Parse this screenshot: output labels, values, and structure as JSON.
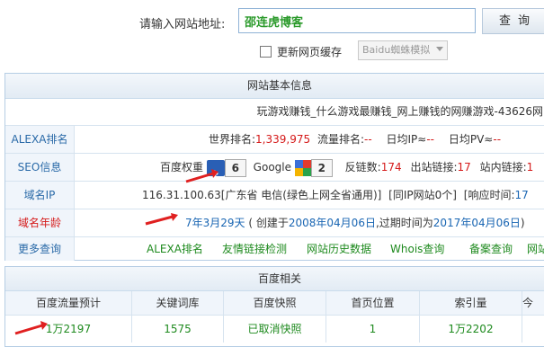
{
  "query": {
    "label": "请输入网站地址:",
    "url_value": "邵连虎博客",
    "button": "查询",
    "refresh_cache_label": "更新网页缓存",
    "spider_select": "Baidu蜘蛛模拟"
  },
  "basic": {
    "header": "网站基本信息",
    "title_text": "玩游戏赚钱_什么游戏最赚钱_网上赚钱的网赚游戏-43626网",
    "alexa": {
      "label": "ALEXA排名",
      "world_rank_label": "世界排名:",
      "world_rank_value": "1,339,975",
      "traffic_rank_label": "流量排名:",
      "traffic_rank_value": "--",
      "daily_ip_label": "日均IP≈",
      "daily_ip_value": "--",
      "daily_pv_label": "日均PV≈",
      "daily_pv_value": "--"
    },
    "seo": {
      "label": "SEO信息",
      "baidu_weight_label": "百度权重",
      "baidu_weight_value": "6",
      "google_label": "Google",
      "google_value": "2",
      "backlinks_label": "反链数:",
      "backlinks_value": "174",
      "outlinks_label": "出站链接:",
      "outlinks_value": "17",
      "inlinks_label": "站内链接:",
      "inlinks_value": "1"
    },
    "ip": {
      "label": "域名IP",
      "value": "116.31.100.63[广东省 电信(绿色上网全省通用)]",
      "same_ip_label": "[同IP网站0个]",
      "response_label": "[响应时间:",
      "response_value": "17"
    },
    "age": {
      "label": "域名年龄",
      "value": "7年3月29天",
      "created_prefix": "( 创建于",
      "created_date": "2008年04月06日",
      "expire_prefix": ",过期时间为",
      "expire_date": "2017年04月06日",
      "suffix": ")"
    },
    "more": {
      "label": "更多查询",
      "links": [
        "ALEXA排名",
        "友情链接检测",
        "网站历史数据",
        "Whois查询",
        "备案查询",
        "网站"
      ]
    }
  },
  "baidu": {
    "header": "百度相关",
    "columns": [
      "百度流量预计",
      "关键词库",
      "百度快照",
      "首页位置",
      "索引量",
      "今"
    ],
    "values": [
      "1万2197",
      "1575",
      "已取消快照",
      "1",
      "1万2202",
      ""
    ]
  },
  "colors": {
    "accent_red": "#d51a1a",
    "link_blue": "#1a66b3",
    "green": "#1e8a1e",
    "arrow_red": "#e02020"
  }
}
